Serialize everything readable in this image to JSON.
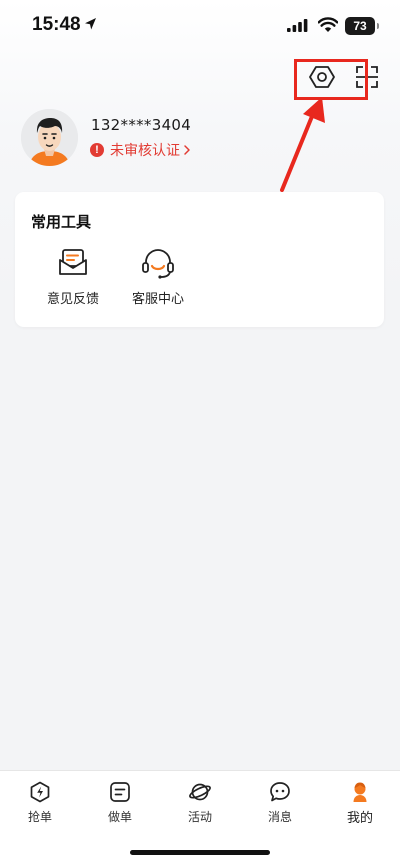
{
  "status_bar": {
    "time": "15:48",
    "battery": "73"
  },
  "profile": {
    "phone": "132****3404",
    "verify_status": "未审核认证"
  },
  "tools": {
    "title": "常用工具",
    "items": [
      {
        "label": "意见反馈",
        "icon": "feedback-mail-icon"
      },
      {
        "label": "客服中心",
        "icon": "headset-icon"
      }
    ]
  },
  "tabs": [
    {
      "label": "抢单",
      "icon": "lightning-hexagon-icon"
    },
    {
      "label": "做单",
      "icon": "note-icon"
    },
    {
      "label": "活动",
      "icon": "planet-icon"
    },
    {
      "label": "消息",
      "icon": "chat-bubble-icon"
    },
    {
      "label": "我的",
      "icon": "user-icon",
      "active": true
    }
  ],
  "colors": {
    "accent": "#f47a20",
    "warning": "#e23b33",
    "annotation": "#e8281e"
  }
}
